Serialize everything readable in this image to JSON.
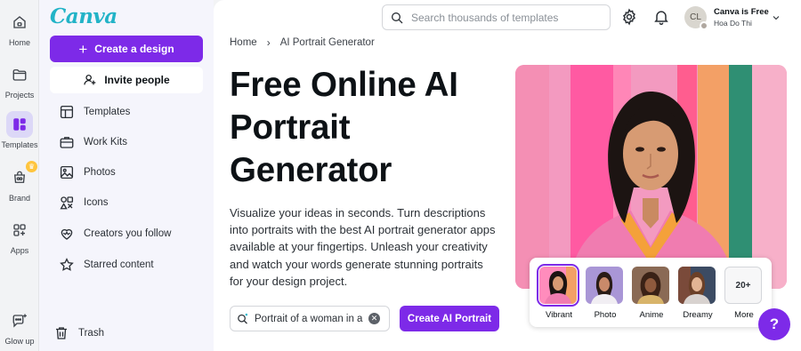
{
  "rail": {
    "items": [
      {
        "label": "Home",
        "icon": "home-icon"
      },
      {
        "label": "Projects",
        "icon": "folder-icon"
      },
      {
        "label": "Templates",
        "icon": "templates-icon",
        "active": true
      },
      {
        "label": "Brand",
        "icon": "brand-icon"
      },
      {
        "label": "Apps",
        "icon": "apps-icon"
      },
      {
        "label": "Glow up",
        "icon": "glow-up-icon"
      }
    ]
  },
  "panel": {
    "logo": "Canva",
    "create_label": "Create a design",
    "invite_label": "Invite people",
    "nav": [
      {
        "label": "Templates",
        "icon": "template-layout-icon"
      },
      {
        "label": "Work Kits",
        "icon": "briefcase-icon"
      },
      {
        "label": "Photos",
        "icon": "image-icon"
      },
      {
        "label": "Icons",
        "icon": "shapes-icon"
      },
      {
        "label": "Creators you follow",
        "icon": "heart-icon"
      },
      {
        "label": "Starred content",
        "icon": "star-icon"
      }
    ],
    "trash_label": "Trash"
  },
  "header": {
    "search_placeholder": "Search thousands of templates",
    "account": {
      "plan": "Canva is Free",
      "name": "Hoa Do Thi",
      "initials": "CL"
    }
  },
  "breadcrumb": {
    "home": "Home",
    "current": "AI Portrait Generator"
  },
  "hero": {
    "title": "Free Online AI Portrait Generator",
    "description": "Visualize your ideas in seconds. Turn descriptions into portraits with the best AI portrait generator apps available at your fingertips. Unleash your creativity and watch your words generate stunning portraits for your design project.",
    "prompt_value": "Portrait of a woman in a",
    "generate_label": "Create AI Portrait"
  },
  "styles": [
    {
      "label": "Vibrant",
      "selected": true
    },
    {
      "label": "Photo"
    },
    {
      "label": "Anime"
    },
    {
      "label": "Dreamy"
    },
    {
      "label": "More",
      "count": "20+"
    }
  ],
  "help_label": "?",
  "colors": {
    "brand_purple": "#7d2ae8",
    "logo_teal": "#22b3c7",
    "hero_pink": "#f39ac0",
    "hero_teal": "#2f8f73",
    "hero_orange": "#f4a13a"
  }
}
